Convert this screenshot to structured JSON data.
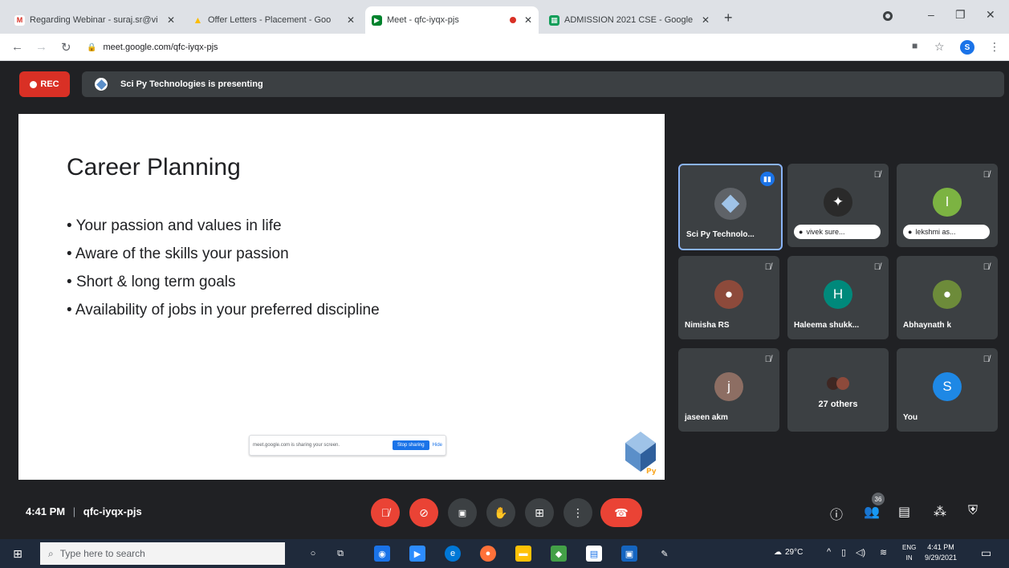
{
  "browser": {
    "tabs": [
      {
        "title": "Regarding Webinar - suraj.sr@vi",
        "icon": "gmail-icon",
        "color": "#d93025",
        "glyph": "M"
      },
      {
        "title": "Offer Letters - Placement - Goo",
        "icon": "drive-icon",
        "color": "#fbbc04",
        "glyph": "▲"
      },
      {
        "title": "Meet - qfc-iyqx-pjs",
        "icon": "meet-icon",
        "color": "#00832d",
        "glyph": "▶"
      },
      {
        "title": "ADMISSION 2021 CSE - Google",
        "icon": "sheets-icon",
        "color": "#0f9d58",
        "glyph": "▦"
      }
    ],
    "new_tab": "+",
    "url": "meet.google.com/qfc-iyqx-pjs",
    "profile_initial": "S"
  },
  "meet": {
    "rec_label": "REC",
    "presenting": "Sci Py Technologies is presenting",
    "slide": {
      "title": "Career Planning",
      "bullets": [
        "Your passion and values in life",
        "Aware of the skills your passion",
        "Short & long term goals",
        "Availability of jobs in your preferred discipline"
      ],
      "share_text": "meet.google.com is sharing your screen.",
      "share_stop": "Stop sharing",
      "share_hide": "Hide"
    },
    "participants": [
      {
        "name": "Sci Py Technolo...",
        "type": "logo",
        "speaking": true
      },
      {
        "name": "vivek sure...",
        "type": "photo",
        "pill": true
      },
      {
        "name": "lekshmi as...",
        "type": "initial",
        "initial": "l",
        "color": "#7cb342",
        "pill": true
      },
      {
        "name": "Nimisha RS",
        "type": "photo"
      },
      {
        "name": "Haleema shukk...",
        "type": "initial",
        "initial": "H",
        "color": "#00897b"
      },
      {
        "name": "Abhaynath k",
        "type": "photo"
      },
      {
        "name": "jaseen akm",
        "type": "initial",
        "initial": "j",
        "color": "#8d6e63"
      },
      {
        "name": "27 others",
        "type": "others"
      },
      {
        "name": "You",
        "type": "initial",
        "initial": "S",
        "color": "#1e88e5"
      }
    ],
    "time": "4:41 PM",
    "meeting_code": "qfc-iyqx-pjs",
    "people_count": "36"
  },
  "taskbar": {
    "search_placeholder": "Type here to search",
    "weather": "29°C",
    "lang_top": "ENG",
    "lang_bottom": "IN",
    "clock_time": "4:41 PM",
    "clock_date": "9/29/2021"
  }
}
